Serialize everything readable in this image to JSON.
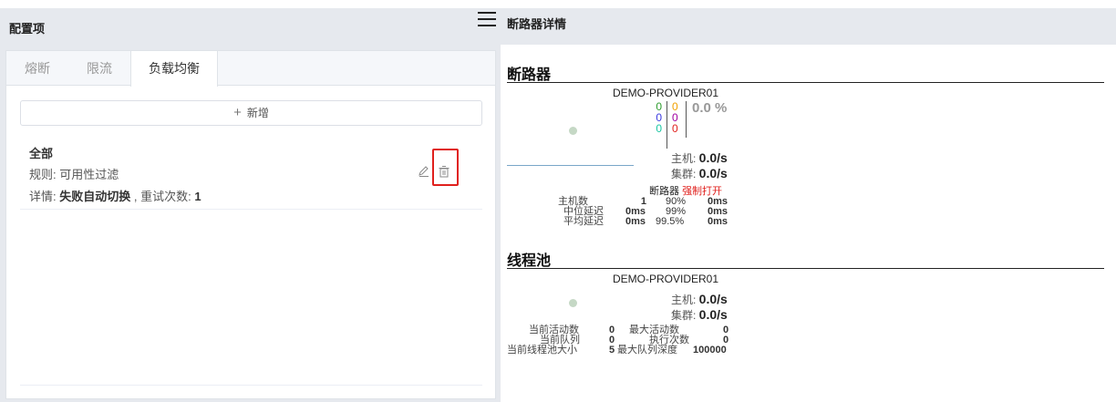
{
  "header": {
    "left_title": "配置项",
    "right_title": "断路器详情"
  },
  "tabs": [
    {
      "label": "熔断",
      "active": false
    },
    {
      "label": "限流",
      "active": false
    },
    {
      "label": "负载均衡",
      "active": true
    }
  ],
  "add_button": {
    "icon": "+",
    "label": "新增"
  },
  "rule": {
    "name": "全部",
    "rule_prefix": "规则: ",
    "rule_value": "可用性过滤",
    "detail_prefix": "详情: ",
    "detail_mode": "失败自动切换",
    "retry_label": " , 重试次数: ",
    "retry_value": "1"
  },
  "circuit_breaker": {
    "section_title": "断路器",
    "service": "DEMO-PROVIDER01",
    "counts_col1": [
      "0",
      "0",
      "0"
    ],
    "counts_col2": [
      "0",
      "0",
      "0"
    ],
    "error_pct": "0.0 %",
    "host_label": "主机: ",
    "host_rate": "0.0/s",
    "cluster_label": "集群: ",
    "cluster_rate": "0.0/s",
    "breaker_label": "断路器 ",
    "breaker_status": "强制打开",
    "stats": [
      {
        "label": "主机数",
        "v1": "1",
        "v2": "90%",
        "v3": "0ms"
      },
      {
        "label": "中位延迟",
        "v1": "0ms",
        "v2": "99%",
        "v3": "0ms"
      },
      {
        "label": "平均延迟",
        "v1": "0ms",
        "v2": "99.5%",
        "v3": "0ms"
      }
    ]
  },
  "thread_pool": {
    "section_title": "线程池",
    "service": "DEMO-PROVIDER01",
    "host_label": "主机: ",
    "host_rate": "0.0/s",
    "cluster_label": "集群: ",
    "cluster_rate": "0.0/s",
    "stats": [
      {
        "label": "当前活动数",
        "v1": "0",
        "label2": "最大活动数",
        "v2": "0"
      },
      {
        "label": "当前队列",
        "v1": "0",
        "label2": "执行次数",
        "v2": "0"
      },
      {
        "label": "当前线程池大小",
        "v1": "5",
        "label2": "最大队列深度",
        "v2": "100000"
      }
    ]
  },
  "colors": {
    "green": "#2e9c2e",
    "blue": "#3a3ae0",
    "teal": "#19c6a2",
    "orange": "#f0a000",
    "purple": "#a000a0",
    "red": "#e0201d",
    "grey": "#999999"
  },
  "icons": [
    "menu-icon",
    "plus-icon",
    "edit-icon",
    "delete-icon"
  ]
}
